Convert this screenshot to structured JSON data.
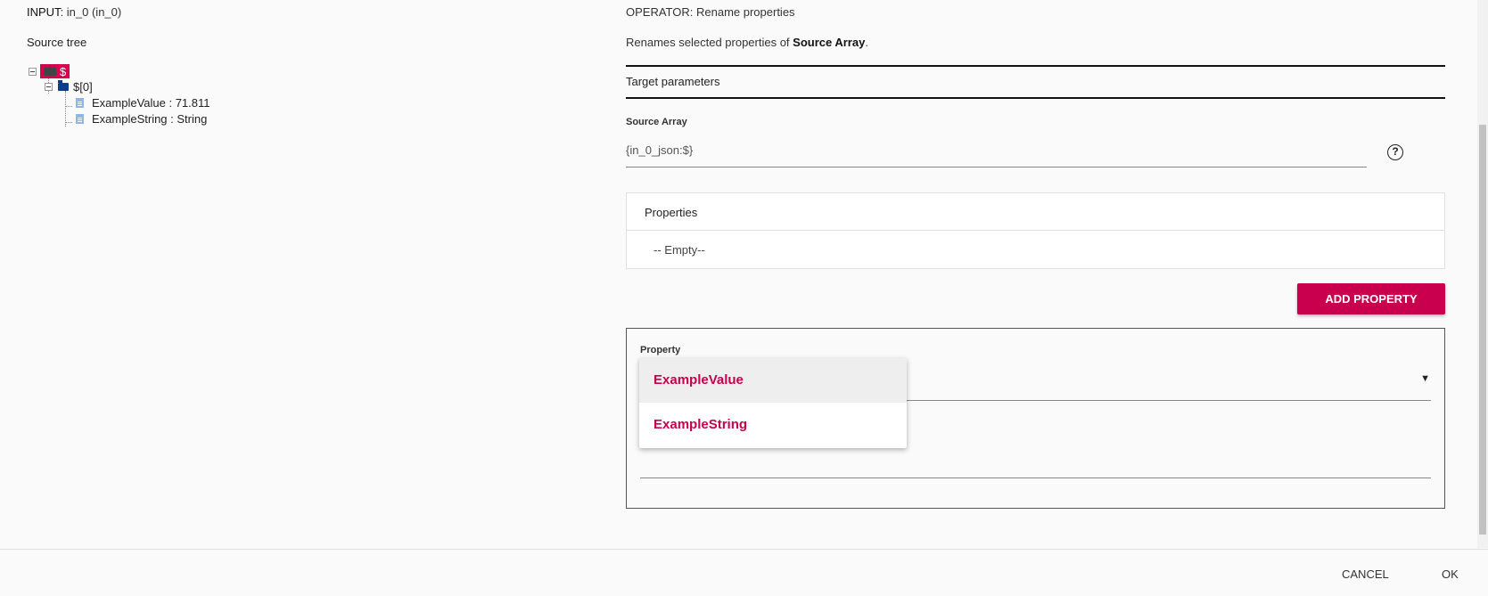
{
  "input": {
    "label": "INPUT",
    "value": ": in_0 (in_0)"
  },
  "source_tree": {
    "title": "Source tree",
    "root": "$",
    "child": "$[0]",
    "leaves": [
      "ExampleValue : 71.811",
      "ExampleString : String"
    ]
  },
  "operator": {
    "label": "OPERATOR",
    "value": ": Rename properties",
    "description_prefix": "Renames selected properties of ",
    "description_bold": "Source Array",
    "description_suffix": "."
  },
  "target_parameters": "Target parameters",
  "source_array": {
    "label": "Source Array",
    "value": "{in_0_json:$}"
  },
  "help_icon": "?",
  "properties": {
    "title": "Properties",
    "empty_text": "-- Empty--"
  },
  "add_property_button": "ADD PROPERTY",
  "property_card": {
    "label": "Property",
    "dropdown_arrow": "▼",
    "options": [
      "ExampleValue",
      "ExampleString"
    ],
    "highlighted_index": 0
  },
  "footer": {
    "cancel": "CANCEL",
    "ok": "OK"
  },
  "colors": {
    "accent": "#c8004d",
    "folder": "#0d3c8c",
    "doc": "#8fb7e6"
  }
}
